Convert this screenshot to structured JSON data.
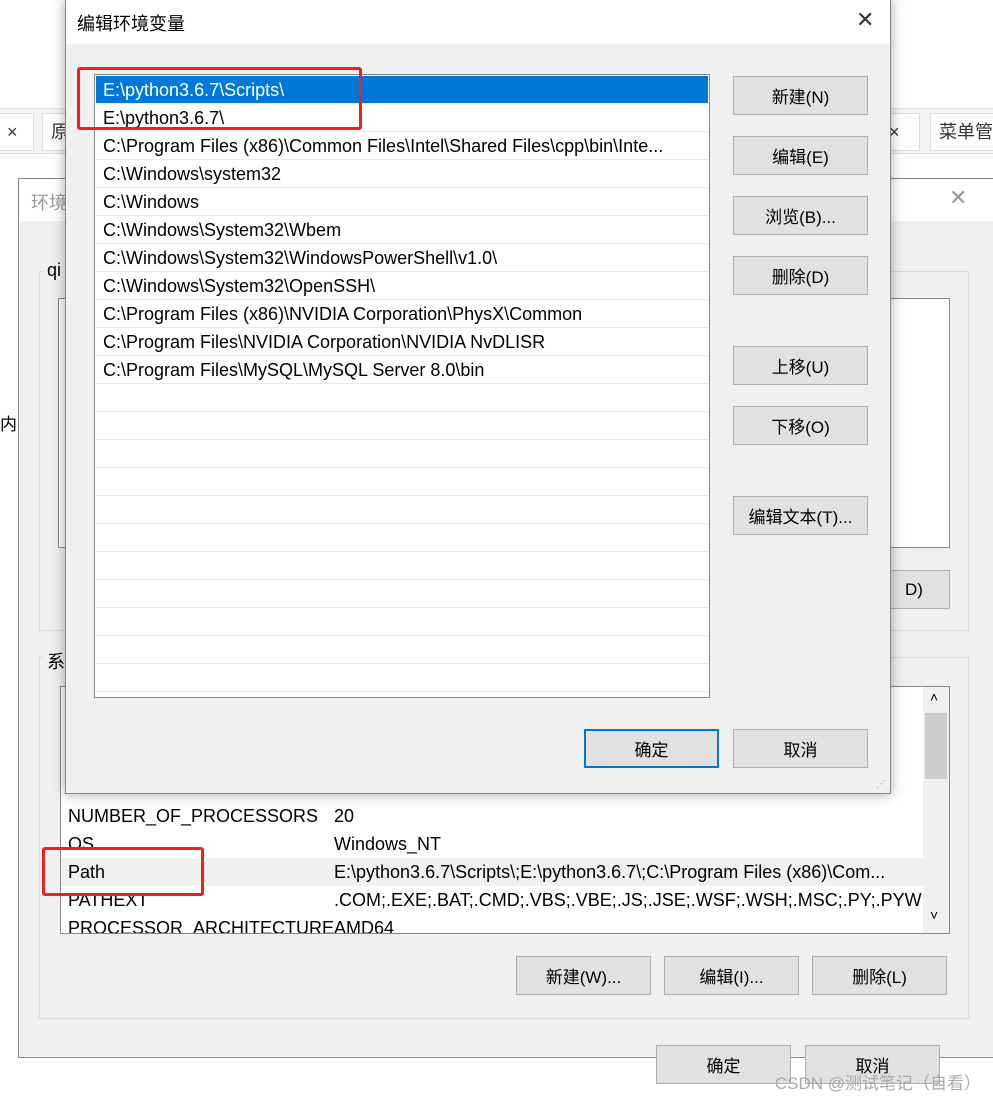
{
  "background_tabs": [
    {
      "label": "×"
    },
    {
      "label": "原"
    },
    {
      "label": "×"
    },
    {
      "label": "菜单管"
    }
  ],
  "env_dialog": {
    "title": "环境",
    "user_group_label": "qi",
    "user_partial_button": "D)",
    "left_partial_text": "内存",
    "system_group_label": "系",
    "system_vars": [
      {
        "name": "NUMBER_OF_PROCESSORS",
        "value": "20"
      },
      {
        "name": "OS",
        "value": "Windows_NT"
      },
      {
        "name": "Path",
        "value": "E:\\python3.6.7\\Scripts\\;E:\\python3.6.7\\;C:\\Program Files (x86)\\Com..."
      },
      {
        "name": "PATHEXT",
        "value": ".COM;.EXE;.BAT;.CMD;.VBS;.VBE;.JS;.JSE;.WSF;.WSH;.MSC;.PY;.PYW"
      },
      {
        "name": "PROCESSOR_ARCHITECTURE",
        "value": "AMD64"
      }
    ],
    "buttons": {
      "new": "新建(W)...",
      "edit": "编辑(I)...",
      "delete": "删除(L)",
      "ok": "确定",
      "cancel": "取消"
    }
  },
  "edit_dialog": {
    "title": "编辑环境变量",
    "paths": [
      "E:\\python3.6.7\\Scripts\\",
      "E:\\python3.6.7\\",
      "C:\\Program Files (x86)\\Common Files\\Intel\\Shared Files\\cpp\\bin\\Inte...",
      "C:\\Windows\\system32",
      "C:\\Windows",
      "C:\\Windows\\System32\\Wbem",
      "C:\\Windows\\System32\\WindowsPowerShell\\v1.0\\",
      "C:\\Windows\\System32\\OpenSSH\\",
      "C:\\Program Files (x86)\\NVIDIA Corporation\\PhysX\\Common",
      "C:\\Program Files\\NVIDIA Corporation\\NVIDIA NvDLISR",
      "C:\\Program Files\\MySQL\\MySQL Server 8.0\\bin"
    ],
    "selected_index": 0,
    "buttons": {
      "new": "新建(N)",
      "edit": "编辑(E)",
      "browse": "浏览(B)...",
      "delete": "删除(D)",
      "up": "上移(U)",
      "down": "下移(O)",
      "edit_text": "编辑文本(T)...",
      "ok": "确定",
      "cancel": "取消"
    }
  },
  "watermark": "CSDN @测试笔记（自看）",
  "colors": {
    "selection": "#0078d7",
    "annotation": "#f02020"
  }
}
